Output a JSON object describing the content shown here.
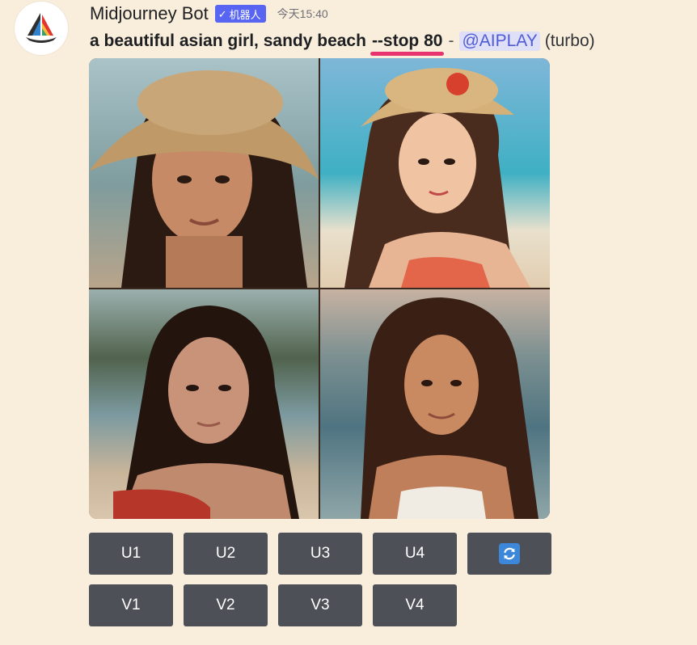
{
  "message": {
    "author": "Midjourney Bot",
    "bot_tag": "机器人",
    "timestamp": "今天15:40",
    "prompt": "a beautiful asian girl, sandy beach",
    "parameter": "--stop 80",
    "separator": "-",
    "mention": "@AIPLAY",
    "mode": "(turbo)"
  },
  "image_grid": {
    "images": [
      {
        "label": "girl-with-straw-hat-blurred-beach"
      },
      {
        "label": "illustrated-girl-with-straw-hat-and-flower"
      },
      {
        "label": "girl-with-long-dark-hair-on-beach"
      },
      {
        "label": "smiling-girl-with-wavy-hair-at-sunset-beach"
      }
    ]
  },
  "buttons": {
    "upscale": [
      "U1",
      "U2",
      "U3",
      "U4"
    ],
    "variation": [
      "V1",
      "V2",
      "V3",
      "V4"
    ],
    "reroll_icon": "refresh-icon"
  },
  "colors": {
    "background": "#f9eedb",
    "button": "#4e5058",
    "bot_tag": "#5865f2",
    "mention": "#4f5bd5",
    "highlight_underline": "#e8336f",
    "reroll_icon_bg": "#3c87d9"
  }
}
